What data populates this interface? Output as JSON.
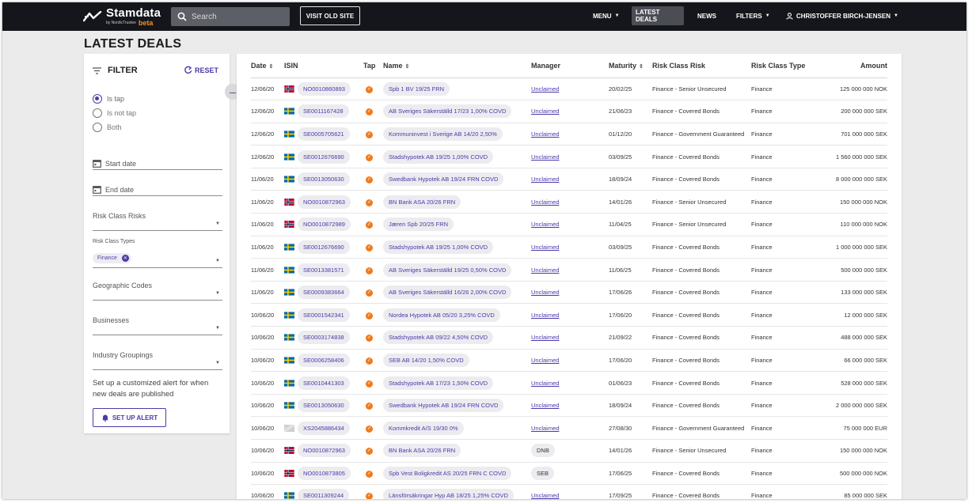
{
  "nav": {
    "brand": "Stamdata",
    "brand_sub": "by NordicTrustee",
    "brand_badge": "beta",
    "search_placeholder": "Search",
    "old_site": "VISIT OLD SITE",
    "menu": "MENU",
    "latest_deals": "LATEST DEALS",
    "news": "NEWS",
    "filters": "FILTERS",
    "user": "CHRISTOFFER BIRCH-JENSEN"
  },
  "page_title": "LATEST DEALS",
  "filter": {
    "title": "FILTER",
    "reset": "RESET",
    "collapse": "–",
    "radios": [
      "Is tap",
      "Is not tap",
      "Both"
    ],
    "start_date": "Start date",
    "end_date": "End date",
    "risk_class_risks": "Risk Class Risks",
    "risk_class_types": "Risk Class Types",
    "risk_type_chip": "Finance",
    "geographic_codes": "Geographic Codes",
    "businesses": "Businesses",
    "industry_groupings": "Industry Groupings",
    "alert_text": "Set up a customized alert for when new deals are published",
    "alert_button": "SET UP ALERT"
  },
  "table": {
    "headers": {
      "date": "Date",
      "isin": "ISIN",
      "tap": "Tap",
      "name": "Name",
      "manager": "Manager",
      "maturity": "Maturity",
      "risk": "Risk Class Risk",
      "type": "Risk Class Type",
      "amount": "Amount"
    },
    "colors": {
      "accent": "#4a3aa8",
      "tap": "#f07b1d",
      "topbar": "#14161b"
    },
    "rows": [
      {
        "date": "12/06/20",
        "flag": "no",
        "isin": "NO0010860893",
        "name": "Spb 1 BV 19/25 FRN",
        "manager": "Unclaimed",
        "maturity": "20/02/25",
        "risk": "Finance - Senior Unsecured",
        "type": "Finance",
        "amount": "125 000 000 NOK"
      },
      {
        "date": "12/06/20",
        "flag": "se",
        "isin": "SE0011167428",
        "name": "AB Sveriges Säkerställd 17/23 1,00% COVD",
        "manager": "Unclaimed",
        "maturity": "21/06/23",
        "risk": "Finance - Covered Bonds",
        "type": "Finance",
        "amount": "200 000 000 SEK"
      },
      {
        "date": "12/06/20",
        "flag": "se",
        "isin": "SE0005705621",
        "name": "Kommuninvest i Sverige AB 14/20 2,50%",
        "manager": "Unclaimed",
        "maturity": "01/12/20",
        "risk": "Finance - Government Guaranteed",
        "type": "Finance",
        "amount": "701 000 000 SEK"
      },
      {
        "date": "12/06/20",
        "flag": "se",
        "isin": "SE0012676690",
        "name": "Stadshypotek AB 19/25 1,00% COVD",
        "manager": "Unclaimed",
        "maturity": "03/09/25",
        "risk": "Finance - Covered Bonds",
        "type": "Finance",
        "amount": "1 560 000 000 SEK"
      },
      {
        "date": "11/06/20",
        "flag": "se",
        "isin": "SE0013050630",
        "name": "Swedbank Hypotek AB 19/24 FRN COVD",
        "manager": "Unclaimed",
        "maturity": "18/09/24",
        "risk": "Finance - Covered Bonds",
        "type": "Finance",
        "amount": "8 000 000 000 SEK"
      },
      {
        "date": "11/06/20",
        "flag": "no",
        "isin": "NO0010872963",
        "name": "BN Bank ASA 20/26 FRN",
        "manager": "Unclaimed",
        "maturity": "14/01/26",
        "risk": "Finance - Senior Unsecured",
        "type": "Finance",
        "amount": "150 000 000 NOK"
      },
      {
        "date": "11/06/20",
        "flag": "no",
        "isin": "NO0010872989",
        "name": "Jæren Spb 20/25 FRN",
        "manager": "Unclaimed",
        "maturity": "11/04/25",
        "risk": "Finance - Senior Unsecured",
        "type": "Finance",
        "amount": "110 000 000 NOK"
      },
      {
        "date": "11/06/20",
        "flag": "se",
        "isin": "SE0012676690",
        "name": "Stadshypotek AB 19/25 1,00% COVD",
        "manager": "Unclaimed",
        "maturity": "03/09/25",
        "risk": "Finance - Covered Bonds",
        "type": "Finance",
        "amount": "1 000 000 000 SEK"
      },
      {
        "date": "11/06/20",
        "flag": "se",
        "isin": "SE0013381571",
        "name": "AB Sveriges Säkerställd 19/25 0,50% COVD",
        "manager": "Unclaimed",
        "maturity": "11/06/25",
        "risk": "Finance - Covered Bonds",
        "type": "Finance",
        "amount": "500 000 000 SEK"
      },
      {
        "date": "11/06/20",
        "flag": "se",
        "isin": "SE0009383664",
        "name": "AB Sveriges Säkerställd 16/26 2,00% COVD",
        "manager": "Unclaimed",
        "maturity": "17/06/26",
        "risk": "Finance - Covered Bonds",
        "type": "Finance",
        "amount": "133 000 000 SEK"
      },
      {
        "date": "10/06/20",
        "flag": "se",
        "isin": "SE0001542341",
        "name": "Nordea Hypotek AB 05/20 3,25% COVD",
        "manager": "Unclaimed",
        "maturity": "17/06/20",
        "risk": "Finance - Covered Bonds",
        "type": "Finance",
        "amount": "12 000 000 SEK"
      },
      {
        "date": "10/06/20",
        "flag": "se",
        "isin": "SE0003174838",
        "name": "Stadshypotek AB 09/22 4,50% COVD",
        "manager": "Unclaimed",
        "maturity": "21/09/22",
        "risk": "Finance - Covered Bonds",
        "type": "Finance",
        "amount": "488 000 000 SEK"
      },
      {
        "date": "10/06/20",
        "flag": "se",
        "isin": "SE0006258406",
        "name": "SEB AB 14/20 1,50% COVD",
        "manager": "Unclaimed",
        "maturity": "17/06/20",
        "risk": "Finance - Covered Bonds",
        "type": "Finance",
        "amount": "66 000 000 SEK"
      },
      {
        "date": "10/06/20",
        "flag": "se",
        "isin": "SE0010441303",
        "name": "Stadshypotek AB 17/23 1,50% COVD",
        "manager": "Unclaimed",
        "maturity": "01/06/23",
        "risk": "Finance - Covered Bonds",
        "type": "Finance",
        "amount": "528 000 000 SEK"
      },
      {
        "date": "10/06/20",
        "flag": "se",
        "isin": "SE0013050630",
        "name": "Swedbank Hypotek AB 19/24 FRN COVD",
        "manager": "Unclaimed",
        "maturity": "18/09/24",
        "risk": "Finance - Covered Bonds",
        "type": "Finance",
        "amount": "2 000 000 000 SEK"
      },
      {
        "date": "10/06/20",
        "flag": "xs",
        "isin": "XS2045886434",
        "name": "Kommkredit A/S 19/30 0%",
        "manager": "Unclaimed",
        "maturity": "27/08/30",
        "risk": "Finance - Government Guaranteed",
        "type": "Finance",
        "amount": "75 000 000 EUR"
      },
      {
        "date": "10/06/20",
        "flag": "no",
        "isin": "NO0010872963",
        "name": "BN Bank ASA 20/26 FRN",
        "manager": "DNB",
        "maturity": "14/01/26",
        "risk": "Finance - Senior Unsecured",
        "type": "Finance",
        "amount": "150 000 000 NOK"
      },
      {
        "date": "10/06/20",
        "flag": "no",
        "isin": "NO0010873805",
        "name": "Spb Vest Boligkredit AS 20/25 FRN C COVD",
        "manager": "SEB",
        "maturity": "17/06/25",
        "risk": "Finance - Covered Bonds",
        "type": "Finance",
        "amount": "500 000 000 NOK"
      },
      {
        "date": "10/06/20",
        "flag": "se",
        "isin": "SE0011309244",
        "name": "Länsförsäkringar Hyp AB 18/25 1,25% COVD",
        "manager": "Unclaimed",
        "maturity": "17/09/25",
        "risk": "Finance - Covered Bonds",
        "type": "Finance",
        "amount": "85 000 000 SEK"
      }
    ]
  }
}
